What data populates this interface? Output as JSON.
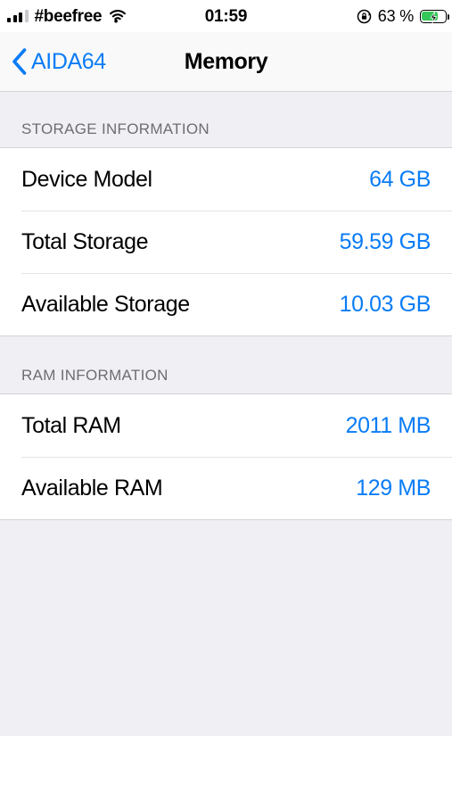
{
  "status_bar": {
    "carrier": "#beefree",
    "signal_icon": "signal-bars-icon",
    "signal_bars_filled": 3,
    "signal_bars_total": 4,
    "wifi_icon": "wifi-icon",
    "time": "01:59",
    "rotation_lock_icon": "rotation-lock-icon",
    "battery_percent": "63 %",
    "battery_icon": "battery-charging-icon",
    "battery_level": 63,
    "charging": true,
    "battery_color": "#34c759"
  },
  "nav_bar": {
    "back_icon": "chevron-left-icon",
    "back_label": "AIDA64",
    "title": "Memory",
    "tint_color": "#0a7cf5"
  },
  "sections": [
    {
      "header": "STORAGE INFORMATION",
      "rows": [
        {
          "label": "Device Model",
          "value": "64 GB"
        },
        {
          "label": "Total Storage",
          "value": "59.59 GB"
        },
        {
          "label": "Available Storage",
          "value": "10.03 GB"
        }
      ]
    },
    {
      "header": "RAM INFORMATION",
      "rows": [
        {
          "label": "Total RAM",
          "value": "2011 MB"
        },
        {
          "label": "Available RAM",
          "value": "129 MB"
        }
      ]
    }
  ],
  "colors": {
    "accent": "#0a7cf5",
    "background": "#f0eff4",
    "row_background": "#ffffff",
    "separator": "#d4d3d8",
    "header_text": "#6d6d72"
  }
}
